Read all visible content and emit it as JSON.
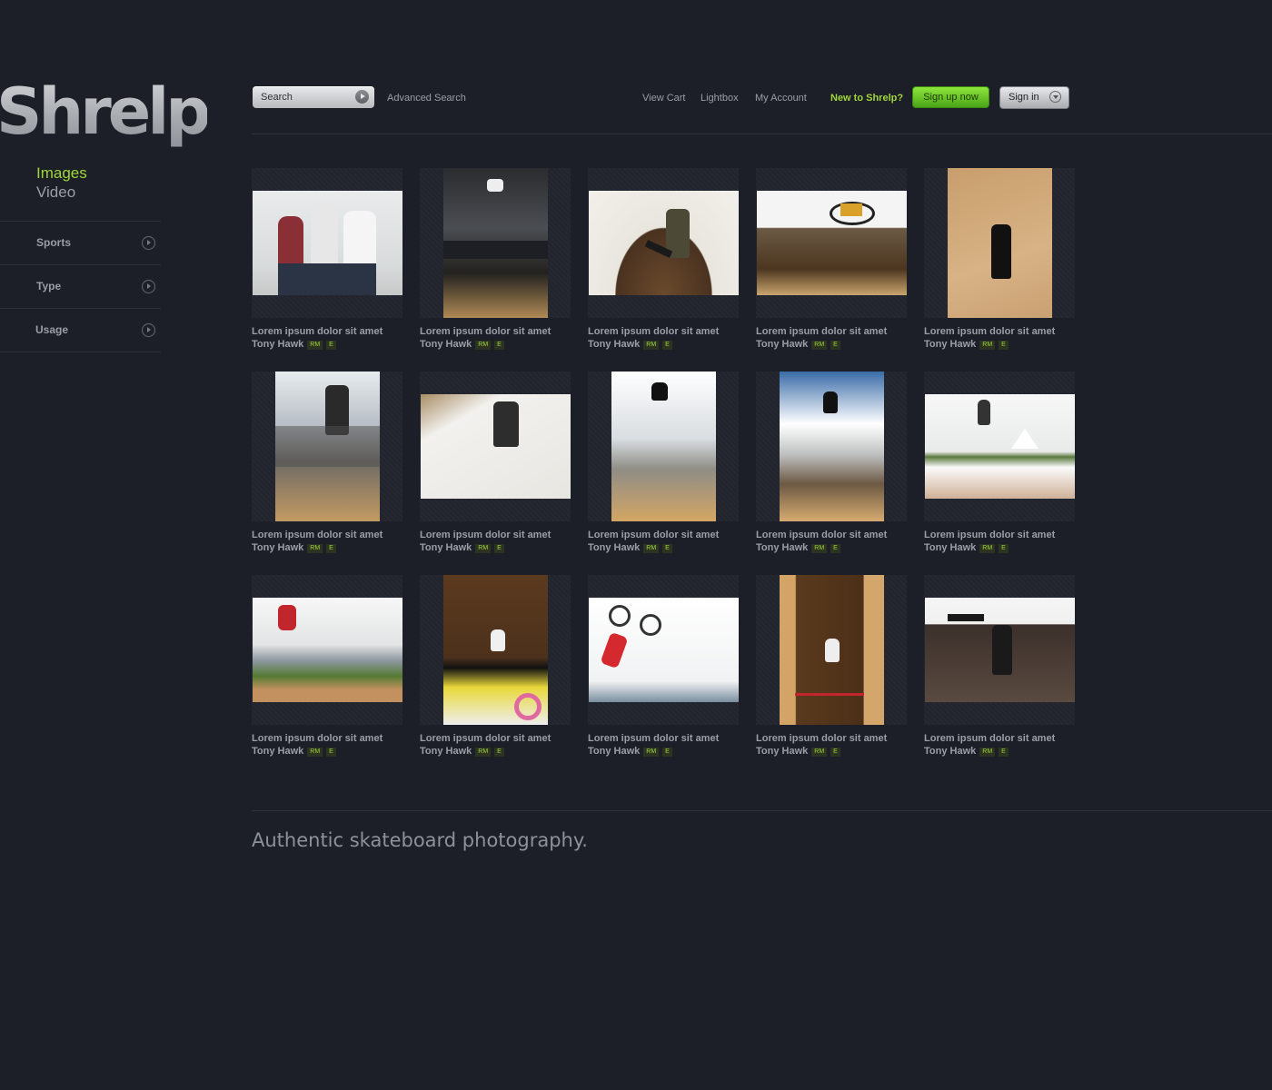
{
  "brand": {
    "logo": "Shrelp"
  },
  "media_nav": {
    "images": "Images",
    "video": "Video"
  },
  "filters": [
    {
      "label": "Sports"
    },
    {
      "label": "Type"
    },
    {
      "label": "Usage"
    }
  ],
  "header": {
    "search_placeholder": "Search",
    "advanced_search": "Advanced Search",
    "view_cart": "View Cart",
    "lightbox": "Lightbox",
    "my_account": "My Account",
    "new_to": "New to Shrelp?",
    "sign_up": "Sign up now",
    "sign_in": "Sign in"
  },
  "grid": {
    "items": [
      {
        "title": "Lorem ipsum dolor sit amet",
        "author": "Tony Hawk",
        "badge_rm": "RM",
        "badge_e": "E"
      },
      {
        "title": "Lorem ipsum dolor sit amet",
        "author": "Tony Hawk",
        "badge_rm": "RM",
        "badge_e": "E"
      },
      {
        "title": "Lorem ipsum dolor sit amet",
        "author": "Tony Hawk",
        "badge_rm": "RM",
        "badge_e": "E"
      },
      {
        "title": "Lorem ipsum dolor sit amet",
        "author": "Tony Hawk",
        "badge_rm": "RM",
        "badge_e": "E"
      },
      {
        "title": "Lorem ipsum dolor sit amet",
        "author": "Tony Hawk",
        "badge_rm": "RM",
        "badge_e": "E"
      },
      {
        "title": "Lorem ipsum dolor sit amet",
        "author": "Tony Hawk",
        "badge_rm": "RM",
        "badge_e": "E"
      },
      {
        "title": "Lorem ipsum dolor sit amet",
        "author": "Tony Hawk",
        "badge_rm": "RM",
        "badge_e": "E"
      },
      {
        "title": "Lorem ipsum dolor sit amet",
        "author": "Tony Hawk",
        "badge_rm": "RM",
        "badge_e": "E"
      },
      {
        "title": "Lorem ipsum dolor sit amet",
        "author": "Tony Hawk",
        "badge_rm": "RM",
        "badge_e": "E"
      },
      {
        "title": "Lorem ipsum dolor sit amet",
        "author": "Tony Hawk",
        "badge_rm": "RM",
        "badge_e": "E"
      },
      {
        "title": "Lorem ipsum dolor sit amet",
        "author": "Tony Hawk",
        "badge_rm": "RM",
        "badge_e": "E"
      },
      {
        "title": "Lorem ipsum dolor sit amet",
        "author": "Tony Hawk",
        "badge_rm": "RM",
        "badge_e": "E"
      },
      {
        "title": "Lorem ipsum dolor sit amet",
        "author": "Tony Hawk",
        "badge_rm": "RM",
        "badge_e": "E"
      },
      {
        "title": "Lorem ipsum dolor sit amet",
        "author": "Tony Hawk",
        "badge_rm": "RM",
        "badge_e": "E"
      },
      {
        "title": "Lorem ipsum dolor sit amet",
        "author": "Tony Hawk",
        "badge_rm": "RM",
        "badge_e": "E"
      }
    ]
  },
  "footer": {
    "tagline": "Authentic skateboard photography."
  },
  "colors": {
    "background": "#1c1f27",
    "accent": "#9fd63a",
    "text": "#9a9ea6"
  }
}
